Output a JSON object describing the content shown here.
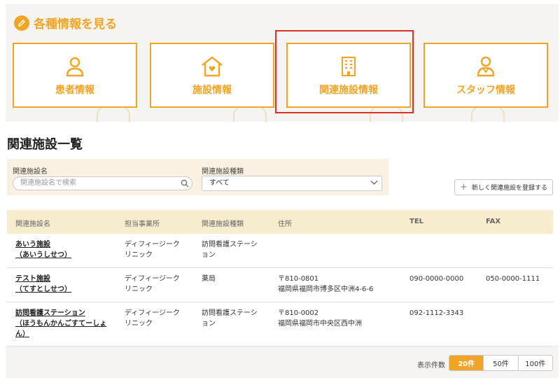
{
  "section_heading": "各種情報を見る",
  "cards": [
    {
      "label": "患者情報",
      "icon": "person-icon"
    },
    {
      "label": "施設情報",
      "icon": "house-heart-icon"
    },
    {
      "label": "関連施設情報",
      "icon": "building-icon"
    },
    {
      "label": "スタッフ情報",
      "icon": "staff-icon"
    }
  ],
  "page_title": "関連施設一覧",
  "filters": {
    "name_label": "関連施設名",
    "name_placeholder": "関連施設名で検索",
    "type_label": "関連施設種類",
    "type_value": "すべて"
  },
  "register_button": "新しく関連施設を登録する",
  "table": {
    "headers": [
      "関連施設名",
      "担当事業所",
      "関連施設種類",
      "住所",
      "TEL",
      "FAX"
    ],
    "rows": [
      {
        "name": "あいう施設",
        "kana": "（あいうしせつ）",
        "office1": "ディフィージーク",
        "office2": "リニック",
        "type1": "訪問看護ステーシ",
        "type2": "ョン",
        "zip": "",
        "addr": "",
        "tel": "",
        "fax": ""
      },
      {
        "name": "テスト施設",
        "kana": "（てすとしせつ）",
        "office1": "ディフィージーク",
        "office2": "リニック",
        "type1": "薬局",
        "type2": "",
        "zip": "〒810-0801",
        "addr": "福岡県福岡市博多区中洲4-6-6",
        "tel": "090-0000-0000",
        "fax": "050-0000-1111"
      },
      {
        "name": "訪問看護ステーション",
        "kana": "（ほうもんかんごすてーしょ",
        "kana2": "ん）",
        "office1": "ディフィージーク",
        "office2": "リニック",
        "type1": "訪問看護ステーシ",
        "type2": "ョン",
        "zip": "〒810-0002",
        "addr": "福岡県福岡市中央区西中洲",
        "tel": "092-1112-3343",
        "fax": ""
      }
    ]
  },
  "pagination": {
    "label": "表示件数",
    "options": [
      "20件",
      "50件",
      "100件"
    ],
    "selected": "20件"
  },
  "colors": {
    "accent": "#f0a526",
    "highlight": "#d9321f",
    "header_bg": "#f8eccf",
    "filter_bg": "#faf1e3"
  }
}
